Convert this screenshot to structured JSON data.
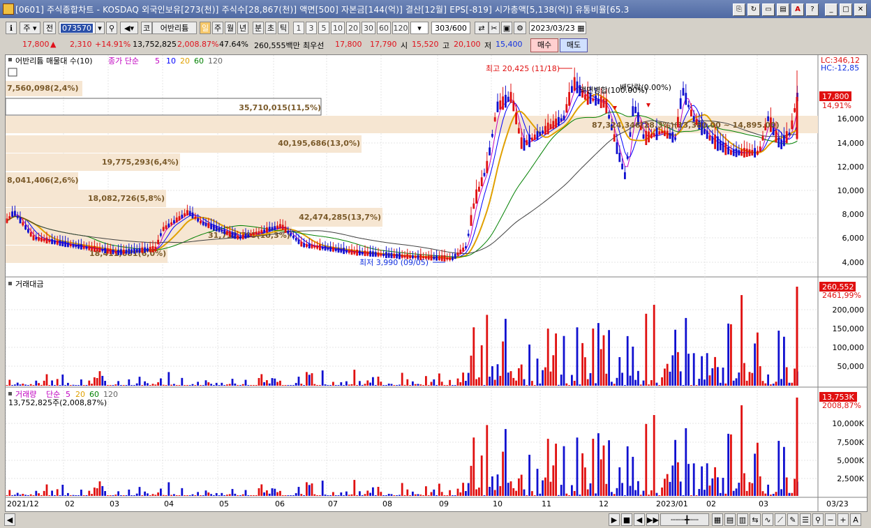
{
  "window": {
    "title": "[0601] 주식종합차트 - KOSDAQ 외국인보유[273(천)] 주식수[28,867(천)] 액면[500] 자본금[144(억)] 결산[12월] EPS[-819] 시가총액[5,138(억)] 유통비율[65.3"
  },
  "toolbar": {
    "market": "주",
    "prev": "전",
    "code": "073570",
    "name_prefix": "코",
    "stock_name": "어반리튬",
    "periods": [
      "일",
      "주",
      "월",
      "년",
      "분",
      "초",
      "틱"
    ],
    "active_period": "일",
    "intervals": [
      "1",
      "3",
      "5",
      "10",
      "20",
      "30",
      "60",
      "120"
    ],
    "count": "303",
    "count_total": "/600",
    "date": "2023/03/23"
  },
  "info": {
    "price": "17,800",
    "change_arrow": "▲",
    "change": "2,310",
    "change_pct": "+14.91%",
    "volume": "13,752,825",
    "volume_pct": "2,008.87%",
    "turnover_pct": "47.64%",
    "amount": "260,555백만",
    "best_label": "최우선",
    "ask": "17,800",
    "bid": "17,790",
    "open_label": "시",
    "open": "15,520",
    "high_label": "고",
    "high": "20,100",
    "low_label": "저",
    "low": "15,400",
    "buy": "매수",
    "sell": "매도"
  },
  "price_pane": {
    "legend_name": "어반리튬 매물대 수(10)",
    "legend_ma": "종가 단순",
    "ma_periods": [
      "5",
      "10",
      "20",
      "60",
      "120"
    ],
    "colors": {
      "ma5": "#c000c0",
      "ma10": "#0000ff",
      "ma20": "#e0a000",
      "ma60": "#008000",
      "ma120": "#404040",
      "up": "#e01010",
      "down": "#1010d0"
    },
    "lc": "LC:346,12",
    "hc": "HC:-12,85",
    "last_box": "17,800",
    "last_pct": "14,91%",
    "y_ticks": [
      "16,000",
      "14,000",
      "12,000",
      "10,000",
      "8,000",
      "6,000",
      "4,000"
    ],
    "annotations": {
      "high": "최고 20,425 (11/18)",
      "low": "최저 3,990 (09/05)",
      "event1": "액면병합(100.00%)",
      "event2": "배당락(0.00%)",
      "vp_current": "87,324,346(28.3%)(13,380.00 ~ 14,895.00)"
    },
    "volume_profile": [
      {
        "label": "7,560,098(2,4%)"
      },
      {
        "label": "35,710,015(11,5%)"
      },
      {
        "label": "40,195,686(13,0%)"
      },
      {
        "label": "19,775,293(6,4%)"
      },
      {
        "label": "8,041,406(2,6%)"
      },
      {
        "label": "18,082,726(5,8%)"
      },
      {
        "label": "42,474,285(13,7%)"
      },
      {
        "label": "31,732,795(10,3%)"
      },
      {
        "label": "18,411,681(6,0%)"
      }
    ]
  },
  "amount_pane": {
    "legend": "거래대금",
    "last_box": "260,552",
    "last_pct": "2461,99%",
    "y_ticks": [
      "200,000",
      "150,000",
      "100,000",
      "50,000"
    ]
  },
  "volume_pane": {
    "legend_name": "거래량",
    "legend_ma": "단순",
    "ma_periods": [
      "5",
      "20",
      "60",
      "120"
    ],
    "sub": "13,752,825주(2,008,87%)",
    "last_box": "13,753K",
    "last_pct": "2008,87%",
    "y_ticks": [
      "10,000K",
      "7,500K",
      "5,000K",
      "2,500K"
    ]
  },
  "x_axis": {
    "labels": [
      "2021/12",
      "02",
      "03",
      "04",
      "05",
      "06",
      "07",
      "08",
      "09",
      "10",
      "11",
      "12",
      "2023/01",
      "02",
      "03"
    ],
    "right_label": "03/23"
  },
  "bottom": {
    "nav": [
      "▶",
      "■",
      "◀",
      "▶▶"
    ]
  }
}
